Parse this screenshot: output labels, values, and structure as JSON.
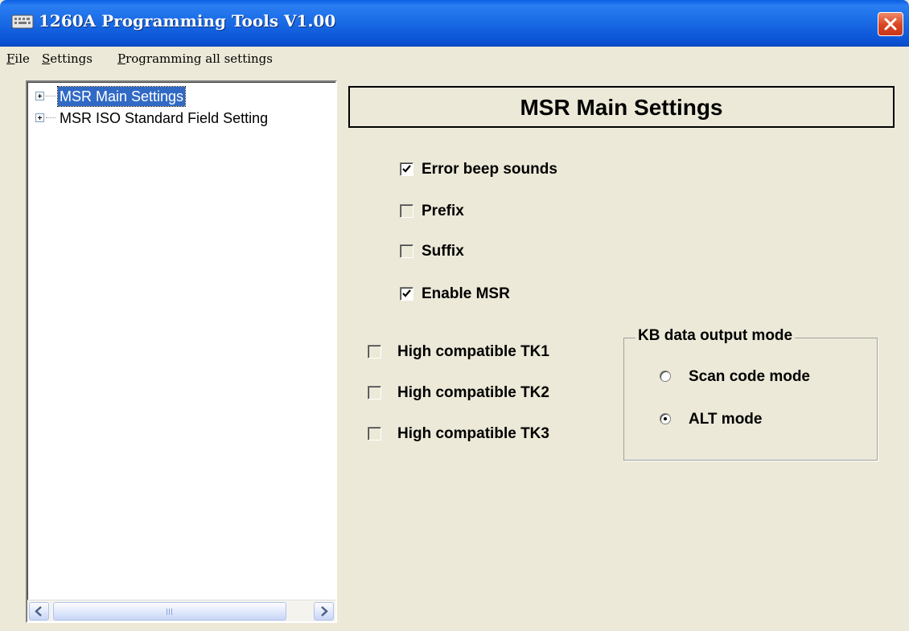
{
  "window": {
    "title": "1260A Programming Tools V1.00",
    "app_icon": "keyboard-icon",
    "close_icon": "close-icon"
  },
  "menu": [
    {
      "label_u": "F",
      "label_rest": "ile"
    },
    {
      "label_u": "S",
      "label_rest": "ettings"
    },
    {
      "label_u": "P",
      "label_rest": "rogramming all settings"
    }
  ],
  "tree": {
    "items": [
      {
        "label": "MSR Main Settings",
        "selected": true
      },
      {
        "label": "MSR ISO Standard Field Setting",
        "selected": false
      }
    ],
    "scroll_left_icon": "arrow-left-icon",
    "scroll_right_icon": "arrow-right-icon"
  },
  "main": {
    "section_title": "MSR Main Settings",
    "options": [
      {
        "label": "Error beep sounds",
        "checked": true
      },
      {
        "label": "Prefix",
        "checked": false
      },
      {
        "label": "Suffix",
        "checked": false
      },
      {
        "label": "Enable MSR",
        "checked": true
      }
    ],
    "compat": [
      {
        "label": "High compatible TK1",
        "checked": false
      },
      {
        "label": "High compatible TK2",
        "checked": false
      },
      {
        "label": "High compatible TK3",
        "checked": false
      }
    ],
    "kb_group": {
      "title": "KB data output mode",
      "options": [
        {
          "label": "Scan code mode",
          "selected": false
        },
        {
          "label": "ALT mode",
          "selected": true
        }
      ]
    }
  },
  "colors": {
    "title_bar": "#0a5fe3",
    "window_bg": "#ece9d8",
    "selection": "#316ac5",
    "close_button": "#d9441f"
  }
}
